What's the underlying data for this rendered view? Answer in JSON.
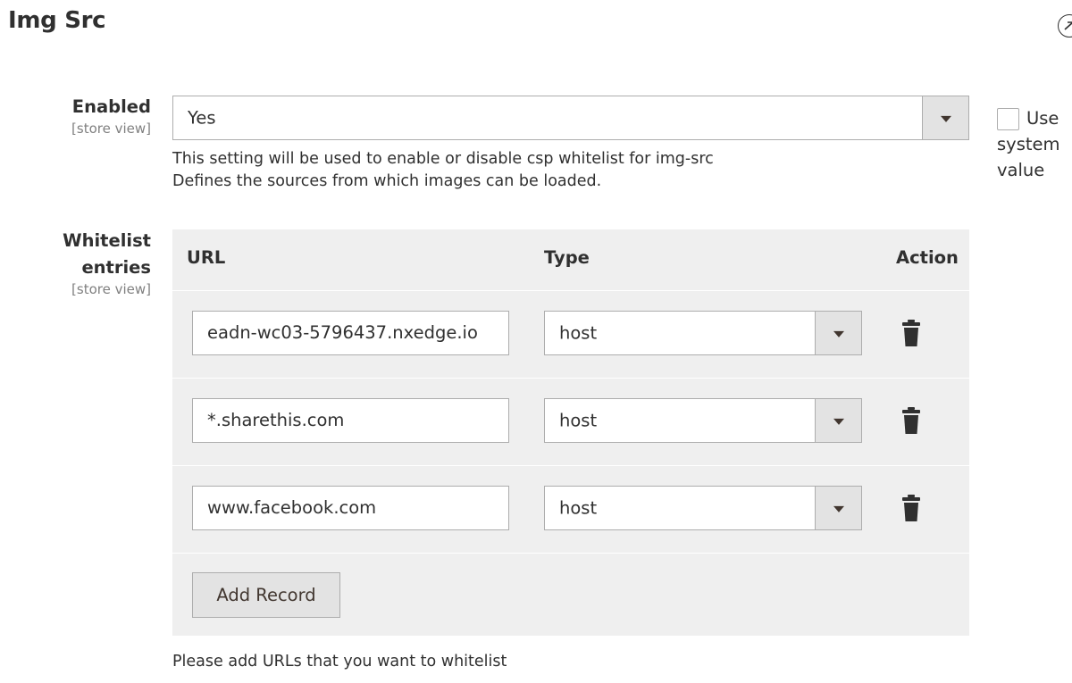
{
  "section": {
    "title": "Img Src"
  },
  "enabled": {
    "label": "Enabled",
    "scope": "[store view]",
    "value": "Yes",
    "note_line1": "This setting will be used to enable or disable csp whitelist for img-src",
    "note_line2": "Defines the sources from which images can be loaded.",
    "use_system": {
      "line1": "Use",
      "line2": "system",
      "line3": "value",
      "checked": false
    }
  },
  "whitelist": {
    "label_line1": "Whitelist",
    "label_line2": "entries",
    "scope": "[store view]",
    "columns": {
      "url": "URL",
      "type": "Type",
      "action": "Action"
    },
    "rows": [
      {
        "url": "eadn-wc03-5796437.nxedge.io",
        "type": "host"
      },
      {
        "url": "*.sharethis.com",
        "type": "host"
      },
      {
        "url": "www.facebook.com",
        "type": "host"
      }
    ],
    "add_button": "Add Record",
    "note": "Please add URLs that you want to whitelist"
  },
  "icons": {
    "collapse": "chevron-collapse-icon",
    "trash": "trash-icon",
    "dropdown": "chevron-down-icon"
  }
}
